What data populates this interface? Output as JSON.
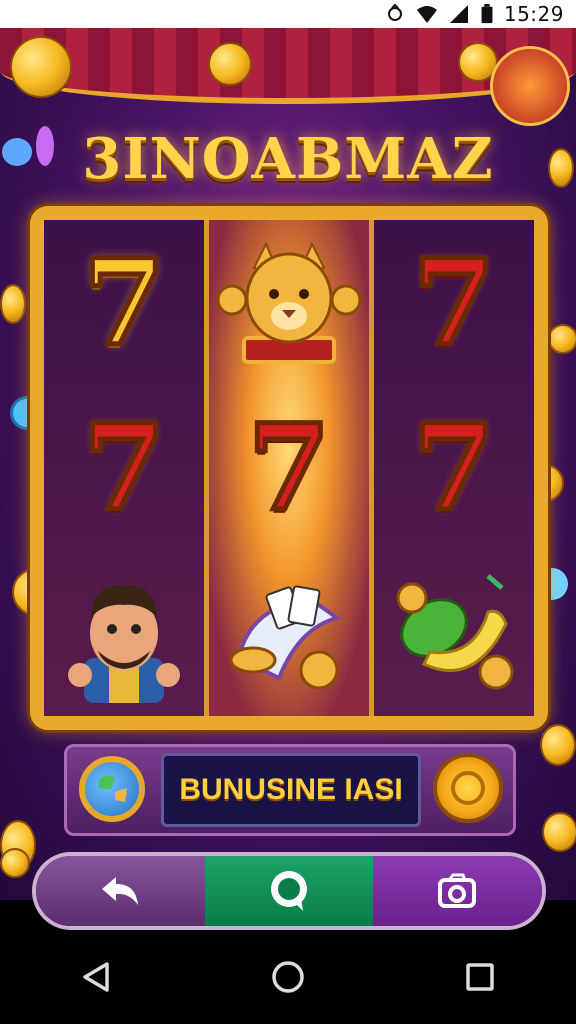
{
  "status_bar": {
    "time": "15:29"
  },
  "game": {
    "title": "3INOABMAZ",
    "reels": [
      [
        "7",
        "7",
        "character"
      ],
      [
        "mascot",
        "7",
        "cards"
      ],
      [
        "7",
        "7",
        "fruit"
      ]
    ],
    "bonus_label": "BUNUSINE IASI"
  },
  "colors": {
    "gold": "#e9a92c",
    "red_seven": "#d81f1f",
    "gold_seven": "#f7c72f",
    "chat_green": "#0a7b49"
  },
  "action_bar": {
    "icons": [
      "back-arrow-icon",
      "chat-icon",
      "screenshot-icon"
    ]
  },
  "nav_bar": {
    "icons": [
      "back-triangle-icon",
      "home-circle-icon",
      "recents-square-icon"
    ]
  }
}
